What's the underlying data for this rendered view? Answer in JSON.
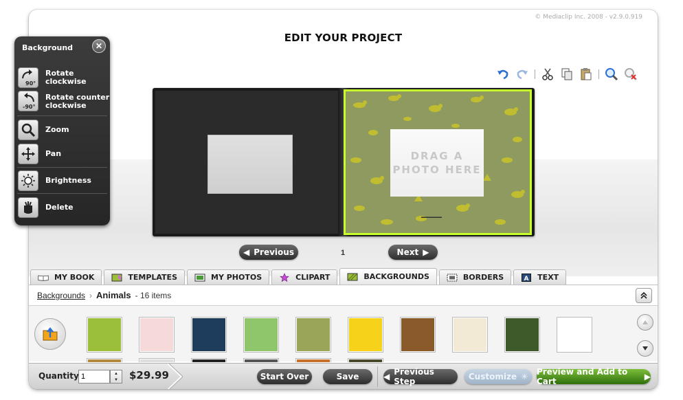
{
  "copyright": "© Mediaclip Inc. 2008 - v2.9.0.919",
  "page_title": "EDIT YOUR PROJECT",
  "toolbar": {
    "icons": [
      "undo-icon",
      "redo-icon",
      "cut-icon",
      "copy-icon",
      "paste-icon",
      "zoom-icon",
      "remove-zoom-icon"
    ]
  },
  "canvas": {
    "drop_text_line1": "DRAG A",
    "drop_text_line2": "PHOTO HERE",
    "page_number": "1",
    "previous_label": "Previous",
    "next_label": "Next"
  },
  "tabs": [
    {
      "label": "MY BOOK"
    },
    {
      "label": "TEMPLATES"
    },
    {
      "label": "MY PHOTOS"
    },
    {
      "label": "CLIPART"
    },
    {
      "label": "BACKGROUNDS"
    },
    {
      "label": "BORDERS"
    },
    {
      "label": "TEXT"
    }
  ],
  "panel": {
    "breadcrumb_link": "Backgrounds",
    "breadcrumb_current": "Animals",
    "item_count": "- 16 items",
    "thumbnails": [
      {
        "color": "#9bbf3a"
      },
      {
        "color": "#f6d9d9"
      },
      {
        "color": "#1e3d5c"
      },
      {
        "color": "#8fc66b"
      },
      {
        "color": "#9aa55a"
      },
      {
        "color": "#f7d21a"
      },
      {
        "color": "#8a5a2b"
      },
      {
        "color": "#f3ead6"
      },
      {
        "color": "#3f5a2a"
      },
      {
        "color": "#ffffff"
      }
    ]
  },
  "bottom": {
    "quantity_label": "Quantity",
    "quantity_value": "1",
    "price": "$29.99",
    "start_over": "Start Over",
    "save": "Save",
    "previous_step": "Previous Step",
    "customize": "Customize",
    "preview_cart": "Preview and Add to Cart"
  },
  "palette": {
    "title": "Background",
    "items": [
      {
        "label": "Rotate clockwise",
        "icon": "rotate-clockwise-icon"
      },
      {
        "label": "Rotate counter clockwise",
        "icon": "rotate-counter-clockwise-icon"
      },
      {
        "label": "Zoom",
        "icon": "zoom-icon"
      },
      {
        "label": "Pan",
        "icon": "pan-icon"
      },
      {
        "label": "Brightness",
        "icon": "brightness-icon"
      },
      {
        "label": "Delete",
        "icon": "delete-icon"
      }
    ],
    "rotate_cw_badge": "90°",
    "rotate_ccw_badge": "-90°"
  },
  "colors": {
    "accent_green": "#c8ff2a",
    "cart_green": "#4a9a1e",
    "dark_button": "#3a3a3a"
  }
}
